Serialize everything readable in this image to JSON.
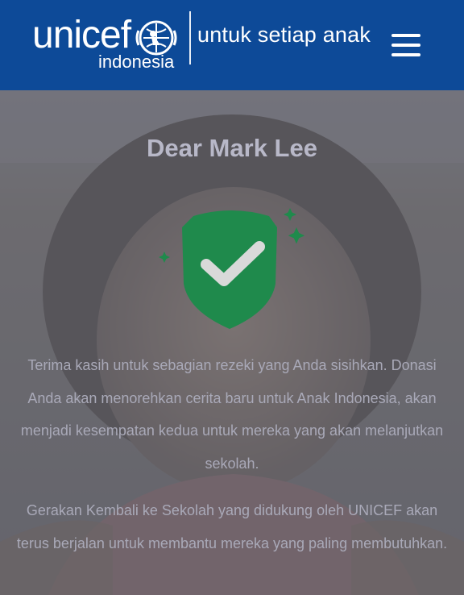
{
  "header": {
    "logo_word": "unicef",
    "logo_sub": "indonesia",
    "tagline": "untuk setiap anak",
    "menu_icon": "hamburger-menu-icon"
  },
  "colors": {
    "header_bg": "#0d4a98",
    "shield_green": "#1f8a4c",
    "title_text": "#b8b8c8",
    "body_text": "#a9a9b8"
  },
  "main": {
    "title": "Dear Mark Lee",
    "icon": "shield-check-icon",
    "paragraph1": "Terima kasih untuk sebagian rezeki yang Anda sisihkan. Donasi Anda akan menorehkan cerita baru untuk Anak Indonesia, akan menjadi kesempatan kedua untuk mereka yang akan melanjutkan sekolah.",
    "paragraph2": "Gerakan Kembali ke Sekolah yang didukung oleh UNICEF akan terus berjalan untuk membantu mereka yang paling membutuhkan."
  }
}
